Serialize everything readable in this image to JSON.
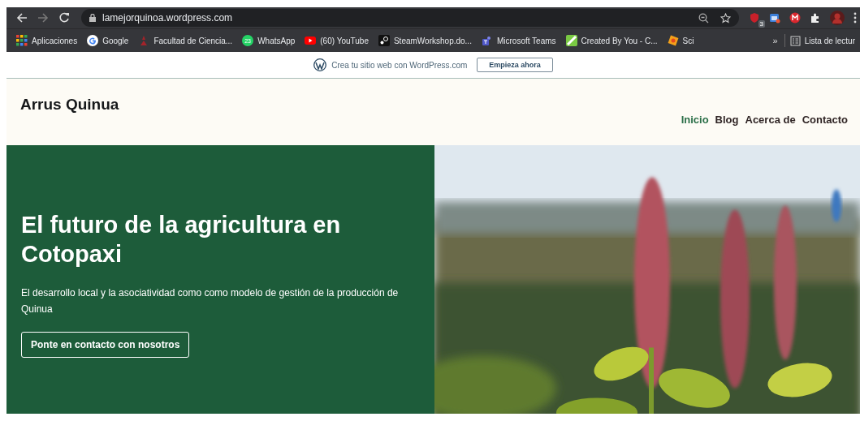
{
  "browser": {
    "url": "lamejorquinoa.wordpress.com",
    "extension_badge": "3",
    "bookmarks": [
      {
        "label": "Aplicaciones"
      },
      {
        "label": "Google"
      },
      {
        "label": "Facultad de Ciencia..."
      },
      {
        "label": "WhatsApp",
        "badge": "23"
      },
      {
        "label": "(60) YouTube"
      },
      {
        "label": "SteamWorkshop.do..."
      },
      {
        "label": "Microsoft Teams"
      },
      {
        "label": "Created By You - C..."
      },
      {
        "label": "Sci"
      }
    ],
    "overflow": "»",
    "reading_list": "Lista de lectur"
  },
  "wp_banner": {
    "text": "Crea tu sitio web con WordPress.com",
    "button": "Empieza ahora"
  },
  "site": {
    "title": "Arrus Quinua",
    "nav": [
      {
        "label": "Inicio",
        "selected": true
      },
      {
        "label": "Blog",
        "selected": false
      },
      {
        "label": "Acerca de",
        "selected": false
      },
      {
        "label": "Contacto",
        "selected": false
      }
    ]
  },
  "hero": {
    "title": "El futuro de la agricultura en Cotopaxi",
    "text": "El desarrollo local y la asociatividad como como modelo de gestión de la producción de Quinua",
    "button": "Ponte en contacto con nosotros"
  }
}
